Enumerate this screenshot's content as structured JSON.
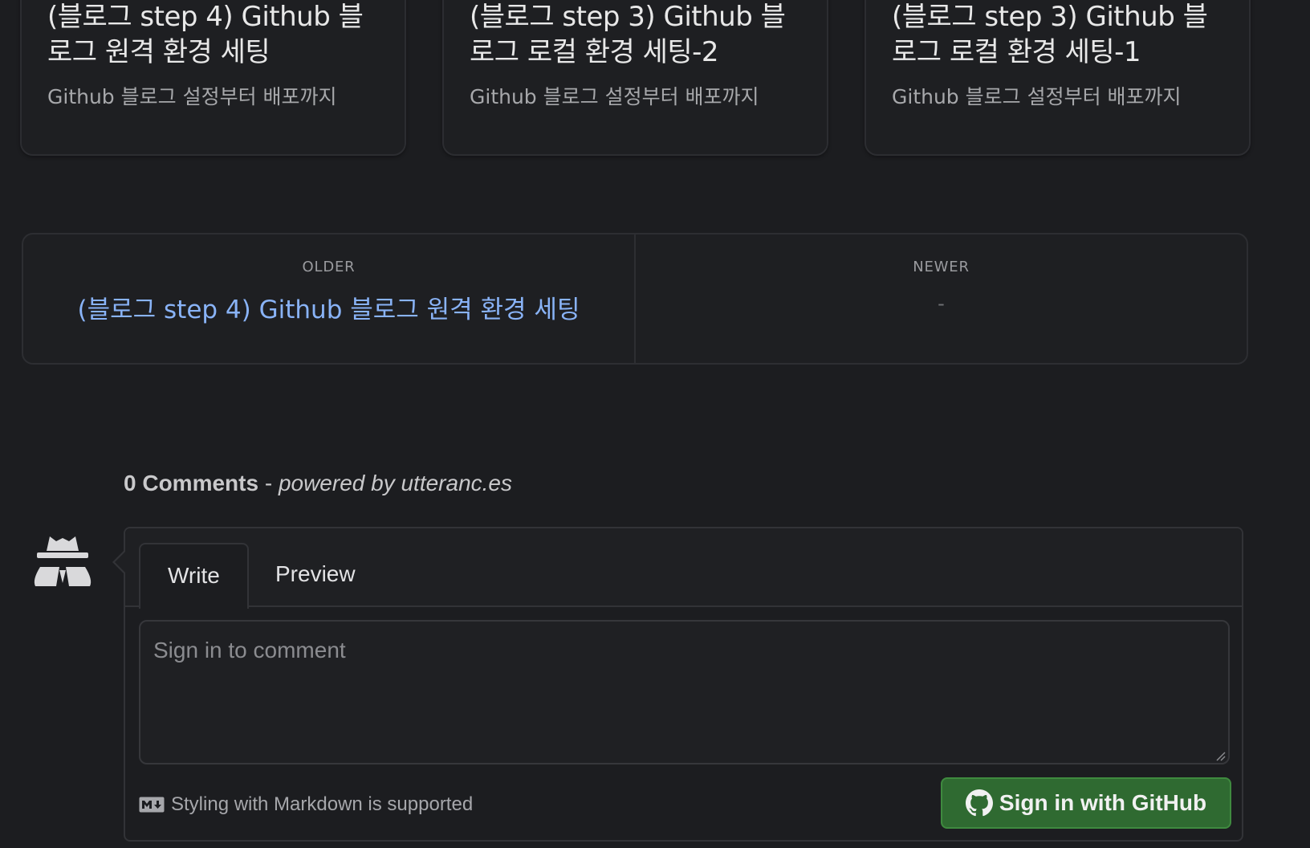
{
  "related_posts": [
    {
      "title": "(블로그 step 4) Github 블로그 원격 환경 세팅",
      "subtitle": "Github 블로그 설정부터 배포까지"
    },
    {
      "title": "(블로그 step 3) Github 블로그 로컬 환경 세팅-2",
      "subtitle": "Github 블로그 설정부터 배포까지"
    },
    {
      "title": "(블로그 step 3) Github 블로그 로컬 환경 세팅-1",
      "subtitle": "Github 블로그 설정부터 배포까지"
    }
  ],
  "pager": {
    "older_caption": "OLDER",
    "older_title": "(블로그 step 4) Github 블로그 원격 환경 세팅",
    "newer_caption": "NEWER",
    "newer_title": "-"
  },
  "comments": {
    "count_label": "0 Comments",
    "separator": " - ",
    "powered_by": "powered by utteranc.es",
    "avatar_icon": "anonymous-spy-icon",
    "tabs": [
      "Write",
      "Preview"
    ],
    "placeholder": "Sign in to comment",
    "markdown_note": "Styling with Markdown is supported",
    "markdown_icon": "markdown-icon",
    "signin_label": "Sign in with GitHub",
    "signin_icon": "github-icon"
  },
  "colors": {
    "background": "#1c1d20",
    "link": "#89b3f7",
    "button_green": "#2f6a31"
  }
}
